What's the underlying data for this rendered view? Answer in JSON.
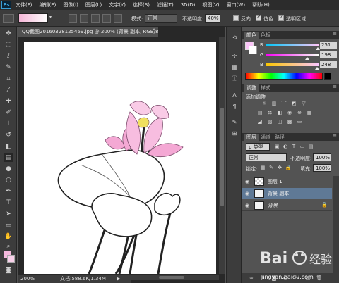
{
  "app": {
    "logo": "Ps"
  },
  "menu": [
    "文件(F)",
    "编辑(E)",
    "图像(I)",
    "图层(L)",
    "文字(Y)",
    "选择(S)",
    "滤镜(T)",
    "3D(D)",
    "视图(V)",
    "窗口(W)",
    "帮助(H)"
  ],
  "options": {
    "mode_label": "模式:",
    "mode_value": "正常",
    "opacity_label": "不透明度:",
    "opacity_value": "40%",
    "reverse_label": "反向",
    "dither_label": "仿色",
    "transparency_label": "透明区域",
    "gradient_colors": [
      "#f5b6d8",
      "#ffffff"
    ]
  },
  "document": {
    "tab_title": "QQ截图20160328125459.jpg @ 200% (背景 副本, RGB/8#) *",
    "close_glyph": "×",
    "zoom": "200%",
    "doc_info": "文档:588.6K/1.34M",
    "status_arrow": "▶"
  },
  "color_panel": {
    "tabs": [
      "颜色",
      "色板"
    ],
    "r_label": "R",
    "g_label": "G",
    "b_label": "B",
    "r": "251",
    "g": "198",
    "b": "248",
    "fg_color": "#fbc6f8",
    "r_fraction": 0.98,
    "g_fraction": 0.78,
    "b_fraction": 0.97
  },
  "adjust_panel": {
    "tabs": [
      "调整",
      "样式"
    ],
    "title": "添加调整"
  },
  "layers_panel": {
    "tabs": [
      "图层",
      "通道",
      "路径"
    ],
    "kind_label": "ρ 类型",
    "blend_mode": "正常",
    "opacity_label": "不透明度:",
    "opacity_value": "100%",
    "lock_label": "锁定:",
    "fill_label": "填充:",
    "fill_value": "100%",
    "layers": [
      {
        "name": "图层 1",
        "selected": false
      },
      {
        "name": "背景 副本",
        "selected": true
      },
      {
        "name": "背景",
        "selected": false
      }
    ]
  },
  "watermark": {
    "text": "jingyan.baidu.com",
    "logo_text": "Bai 经验"
  }
}
